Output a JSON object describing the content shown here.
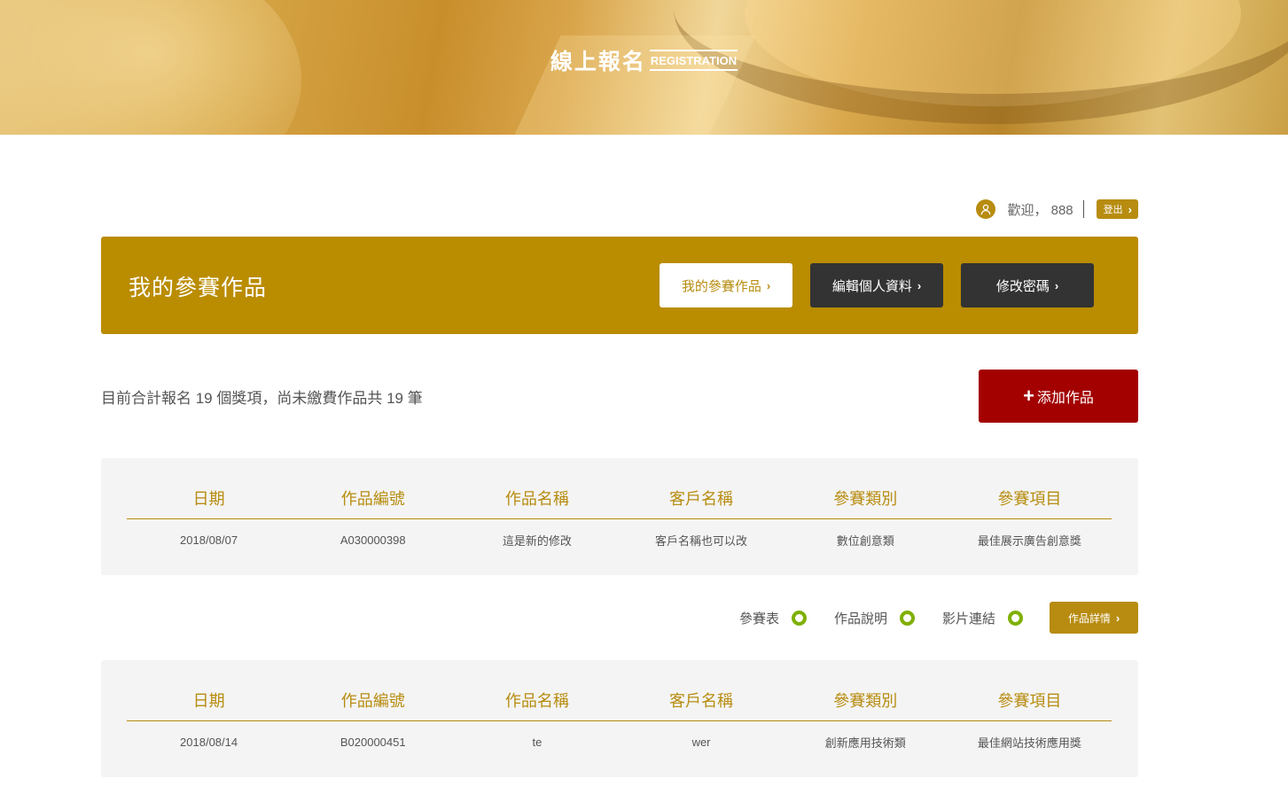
{
  "header": {
    "title_zh": "線上報名",
    "title_en": "REGISTRATION"
  },
  "user": {
    "welcome_text": "歡迎， 888",
    "logout_label": "登出"
  },
  "banner": {
    "title": "我的參賽作品",
    "buttons": [
      {
        "label": "我的參賽作品"
      },
      {
        "label": "編輯個人資料"
      },
      {
        "label": "修改密碼"
      }
    ]
  },
  "summary_text": "目前合計報名 19 個獎項，尚未繳費作品共 19 筆",
  "add_button_label": "添加作品",
  "columns": [
    "日期",
    "作品編號",
    "作品名稱",
    "客戶名稱",
    "參賽類別",
    "參賽項目"
  ],
  "entries": [
    {
      "date": "2018/08/07",
      "code": "A030000398",
      "name": "這是新的修改",
      "client": "客戶名稱也可以改",
      "category": "數位創意類",
      "item": "最佳展示廣告創意獎"
    },
    {
      "date": "2018/08/14",
      "code": "B020000451",
      "name": "te",
      "client": "wer",
      "category": "創新應用技術類",
      "item": "最佳網站技術應用獎"
    }
  ],
  "status": {
    "items": [
      {
        "label": "參賽表"
      },
      {
        "label": "作品說明"
      },
      {
        "label": "影片連結"
      }
    ],
    "detail_button_label": "作品詳情"
  },
  "colors": {
    "gold": "#b78c10",
    "banner_gold": "#ba8c00",
    "dark_button": "#333333",
    "add_red": "#a30000",
    "status_green": "#7fb000",
    "panel_gray": "#f4f4f4"
  }
}
